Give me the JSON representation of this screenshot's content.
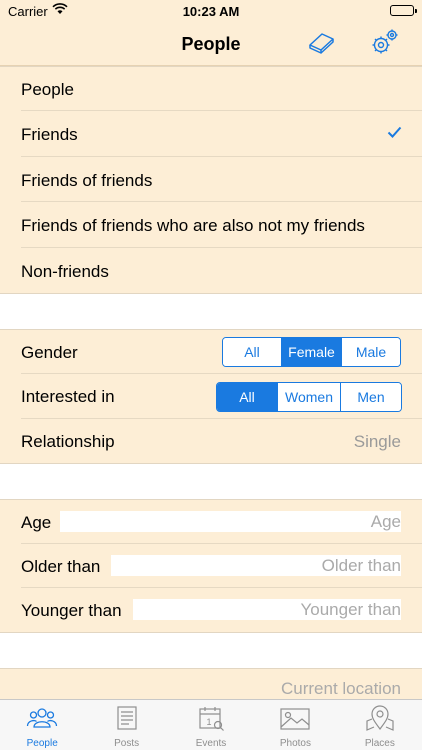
{
  "status_bar": {
    "carrier": "Carrier",
    "time": "10:23 AM"
  },
  "nav": {
    "title": "People",
    "left_icon": "eraser-icon",
    "right_icon": "gear-icon"
  },
  "colors": {
    "accent": "#1a7ae0",
    "row_background": "#fdeed6",
    "placeholder": "#9a9a9a"
  },
  "relation_options": [
    {
      "label": "People",
      "checked": false
    },
    {
      "label": "Friends",
      "checked": true
    },
    {
      "label": "Friends of friends",
      "checked": false
    },
    {
      "label": "Friends of friends who are also not my friends",
      "checked": false
    },
    {
      "label": "Non-friends",
      "checked": false
    }
  ],
  "gender": {
    "label": "Gender",
    "options": [
      "All",
      "Female",
      "Male"
    ],
    "selected": "Female"
  },
  "interested_in": {
    "label": "Interested in",
    "options": [
      "All",
      "Women",
      "Men"
    ],
    "selected": "All"
  },
  "relationship": {
    "label": "Relationship",
    "value": "Single"
  },
  "age_filters": {
    "age": {
      "label": "Age",
      "placeholder": "Age"
    },
    "older_than": {
      "label": "Older than",
      "placeholder": "Older than"
    },
    "younger_than": {
      "label": "Younger than",
      "placeholder": "Younger than"
    }
  },
  "location": {
    "placeholder": "Current location"
  },
  "tabs": [
    {
      "label": "People",
      "icon": "people-icon",
      "active": true
    },
    {
      "label": "Posts",
      "icon": "posts-icon",
      "active": false
    },
    {
      "label": "Events",
      "icon": "calendar-icon",
      "active": false
    },
    {
      "label": "Photos",
      "icon": "photo-icon",
      "active": false
    },
    {
      "label": "Places",
      "icon": "map-pin-icon",
      "active": false
    }
  ]
}
